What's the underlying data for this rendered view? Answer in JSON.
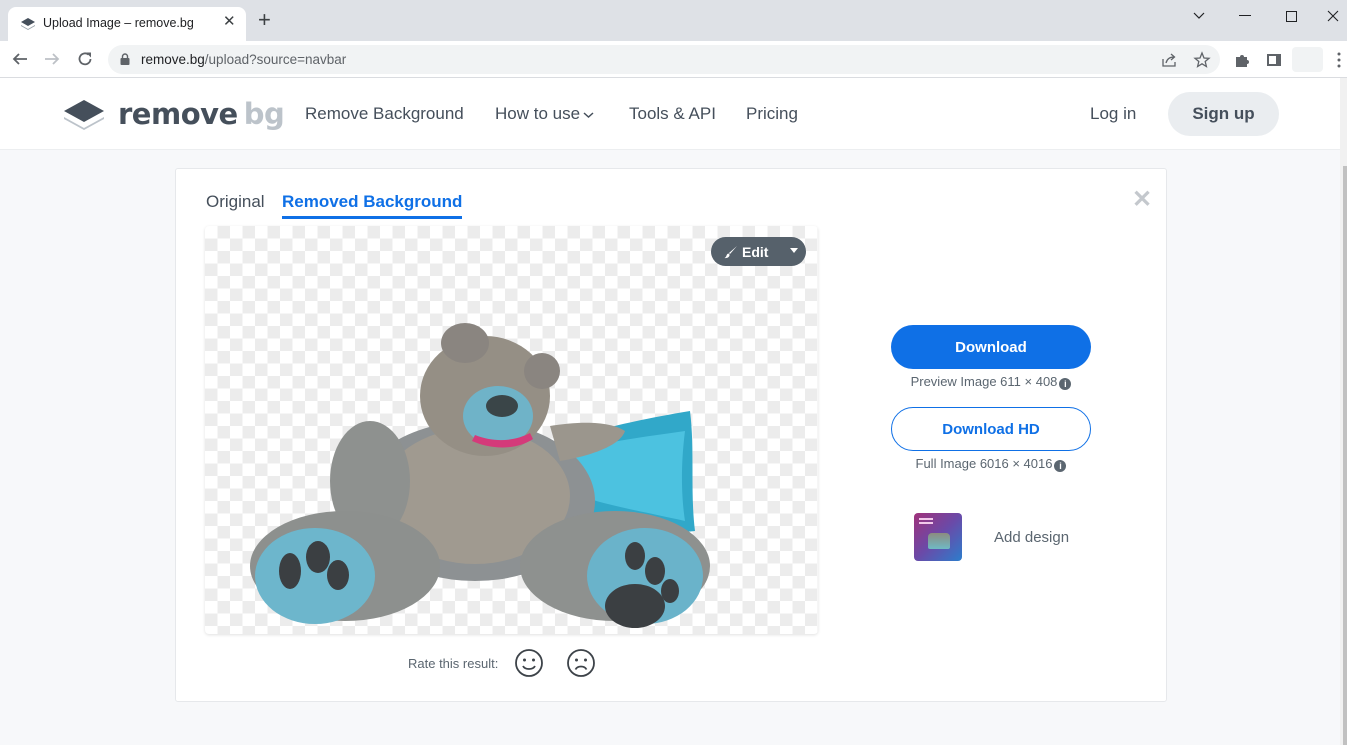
{
  "browser": {
    "tab_title": "Upload Image – remove.bg",
    "url_host": "remove.bg",
    "url_path": "/upload?source=navbar",
    "icons": [
      "back-arrow-icon",
      "forward-arrow-icon",
      "reload-icon",
      "lock-icon",
      "share-icon",
      "bookmark-star-icon",
      "extensions-puzzle-icon",
      "side-panel-icon",
      "kebab-menu-icon",
      "tab-search-chevron-icon",
      "minimize-icon",
      "maximize-icon",
      "close-window-icon"
    ]
  },
  "header": {
    "logo_main": "remove",
    "logo_accent": "bg",
    "nav": [
      {
        "label": "Remove Background"
      },
      {
        "label": "How to use"
      },
      {
        "label": "Tools & API"
      },
      {
        "label": "Pricing"
      }
    ],
    "login": "Log in",
    "signup": "Sign up"
  },
  "result": {
    "tabs": [
      {
        "label": "Original",
        "active": false
      },
      {
        "label": "Removed Background",
        "active": true
      }
    ],
    "close_glyph": "✕",
    "edit_label": "Edit",
    "rate_label": "Rate this result:",
    "download_label": "Download",
    "preview_info": "Preview Image 611 × 408",
    "download_hd_label": "Download HD",
    "full_info": "Full Image 6016 × 4016",
    "add_design_label": "Add design",
    "info_glyph": "i"
  },
  "colors": {
    "accent": "#0f70e6",
    "text": "#454f5b",
    "page_bg": "#f7f8fa"
  }
}
